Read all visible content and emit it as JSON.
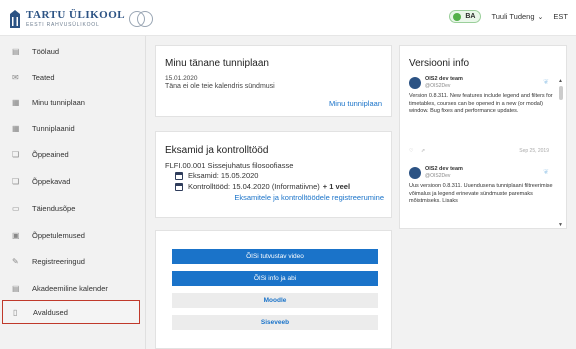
{
  "header": {
    "logo_title": "TARTU ÜLIKOOL",
    "logo_subtitle": "EESTI RAHVUSÜLIKOOL",
    "role_badge": "BA",
    "user_name": "Tuuli Tudeng",
    "language": "EST"
  },
  "sidebar": {
    "items": [
      {
        "label": "Töölaud",
        "icon": "dashboard-icon"
      },
      {
        "label": "Teated",
        "icon": "mail-icon"
      },
      {
        "label": "Minu tunniplaan",
        "icon": "calendar-grid-icon"
      },
      {
        "label": "Tunniplaanid",
        "icon": "calendar-grid-icon"
      },
      {
        "label": "Õppeained",
        "icon": "book-icon"
      },
      {
        "label": "Õppekavad",
        "icon": "book-icon"
      },
      {
        "label": "Täiendusõpe",
        "icon": "folder-icon"
      },
      {
        "label": "Õppetulemused",
        "icon": "certificate-icon"
      },
      {
        "label": "Registreeringud",
        "icon": "register-icon"
      },
      {
        "label": "Akadeemiline kalender",
        "icon": "calendar-icon"
      },
      {
        "label": "Avaldused",
        "icon": "document-icon"
      }
    ]
  },
  "schedule": {
    "title": "Minu tänane tunniplaan",
    "date": "15.01.2020",
    "note": "Täna ei ole teie kalendris sündmusi",
    "link": "Minu tunniplaan"
  },
  "exams": {
    "title": "Eksamid ja kontrolltööd",
    "course": "FLFI.00.001 Sissejuhatus filosoofiasse",
    "exam_line": "Eksamid: 15.05.2020",
    "test_line": "Kontrolltööd: 15.04.2020 (Informatiivne)",
    "more": "+ 1 veel",
    "link": "Eksamitele ja kontrolltöödele registreerumine"
  },
  "quicklinks": {
    "video": "ÕISi tutvustav video",
    "info": "ÕISi info ja abi",
    "moodle": "Moodle",
    "siseveeb": "Siseveeb"
  },
  "versions": {
    "title": "Versiooni info",
    "tweets": [
      {
        "name": "OIS2 dev team",
        "handle": "@OIS2Dev",
        "text": "Version 0.8.311. New features include legend and filters for timetables, courses can be opened in a new (or modal) window. Bug fixes and performance updates.",
        "date": "Sep 25, 2019"
      },
      {
        "name": "OIS2 dev team",
        "handle": "@OIS2Dev",
        "text": "Uus versioon 0.8.311. Uuendusena tunniplaani filtreerimise võimalus ja legend erinevate sündmuste paremaks mõistmiseks. Lisaks"
      }
    ]
  },
  "colors": {
    "accent": "#1a73c9",
    "brand": "#2c5384",
    "active_outline": "#c0392b",
    "badge_green": "#54b04a"
  }
}
